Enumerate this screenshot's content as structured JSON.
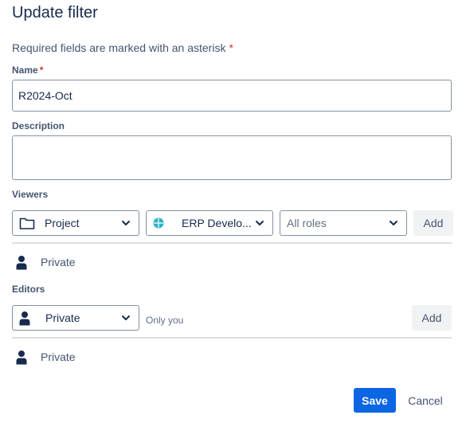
{
  "dialog": {
    "title": "Update filter",
    "required_note": "Required fields are marked with an asterisk",
    "asterisk": "*"
  },
  "name_field": {
    "label": "Name",
    "value": "R2024-Oct"
  },
  "description_field": {
    "label": "Description",
    "value": ""
  },
  "viewers": {
    "label": "Viewers",
    "type_select": {
      "value": "Project",
      "icon": "folder-icon"
    },
    "project_select": {
      "value": "ERP Develo...",
      "icon": "project-avatar-icon",
      "accent": "#2ab4c9"
    },
    "role_select": {
      "placeholder": "All roles"
    },
    "add_label": "Add",
    "shared_items": [
      {
        "label": "Private",
        "icon": "person-icon"
      }
    ]
  },
  "editors": {
    "label": "Editors",
    "type_select": {
      "value": "Private",
      "icon": "person-icon"
    },
    "hint": "Only you",
    "add_label": "Add",
    "shared_items": [
      {
        "label": "Private",
        "icon": "person-icon"
      }
    ]
  },
  "footer": {
    "save_label": "Save",
    "cancel_label": "Cancel"
  },
  "colors": {
    "primary": "#0c66e4",
    "required": "#c9372c",
    "border": "#8590a2",
    "divider": "#dcdfe4"
  }
}
